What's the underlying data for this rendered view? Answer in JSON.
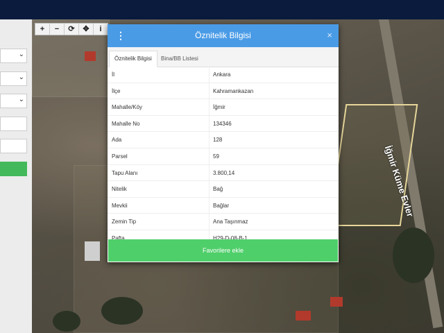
{
  "map": {
    "road_label": "İğmir Küme Evler",
    "toolbar": {
      "zoom_in": "+",
      "zoom_out": "−",
      "refresh": "⟳",
      "locate": "✥",
      "info": "i"
    }
  },
  "dialog": {
    "title": "Öznitelik Bilgisi",
    "menu_icon": "⋮",
    "close_icon": "×",
    "tabs": [
      "Öznitelik Bilgisi",
      "Bina/BB Listesi"
    ],
    "rows": [
      {
        "key": "İl",
        "value": "Ankara"
      },
      {
        "key": "İlçe",
        "value": "Kahramankazan"
      },
      {
        "key": "Mahalle/Köy",
        "value": "İğmir"
      },
      {
        "key": "Mahalle No",
        "value": "134346"
      },
      {
        "key": "Ada",
        "value": "128"
      },
      {
        "key": "Parsel",
        "value": "59"
      },
      {
        "key": "Tapu Alanı",
        "value": "3.800,14"
      },
      {
        "key": "Nitelik",
        "value": "Bağ"
      },
      {
        "key": "Mevkii",
        "value": "Bağlar"
      },
      {
        "key": "Zemin Tip",
        "value": "Ana Taşınmaz"
      },
      {
        "key": "Pafta",
        "value": "H29-D-08-B-1"
      }
    ],
    "favorite_button": "Favorilere ekle"
  },
  "colors": {
    "header": "#4a9be6",
    "favorite": "#4fcf6a",
    "parcel_border": "#e7d79a"
  }
}
